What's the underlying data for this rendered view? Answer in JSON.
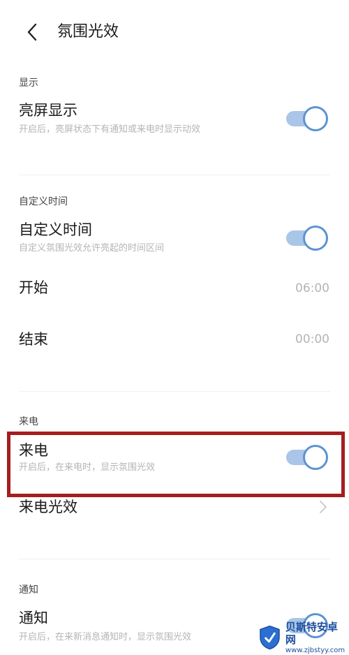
{
  "header": {
    "title": "氛围光效"
  },
  "sections": {
    "display": {
      "header": "显示",
      "screen_on": {
        "title": "亮屏显示",
        "subtitle": "开启后，亮屏状态下有通知或来电时显示动效",
        "enabled": true
      }
    },
    "custom_time": {
      "header": "自定义时间",
      "toggle_row": {
        "title": "自定义时间",
        "subtitle": "自定义氛围光效允许亮起的时间区间",
        "enabled": true
      },
      "start": {
        "label": "开始",
        "value": "06:00"
      },
      "end": {
        "label": "结束",
        "value": "00:00"
      }
    },
    "incoming_call": {
      "header": "来电",
      "toggle_row": {
        "title": "来电",
        "subtitle": "开启后，在来电时，显示氛围光效",
        "enabled": true
      },
      "effect_row": {
        "title": "来电光效"
      }
    },
    "notification": {
      "header": "通知",
      "toggle_row": {
        "title": "通知",
        "subtitle": "开启后，在来新消息通知时，显示氛围光效",
        "enabled": true
      }
    }
  },
  "watermark": {
    "name": "贝斯特安卓网",
    "url": "www.zjbstyy.com"
  },
  "colors": {
    "toggle_track": "#a9c5e8",
    "toggle_ring": "#5c93d4",
    "highlight_border": "#a51e1e",
    "watermark": "#1d4f9c"
  }
}
